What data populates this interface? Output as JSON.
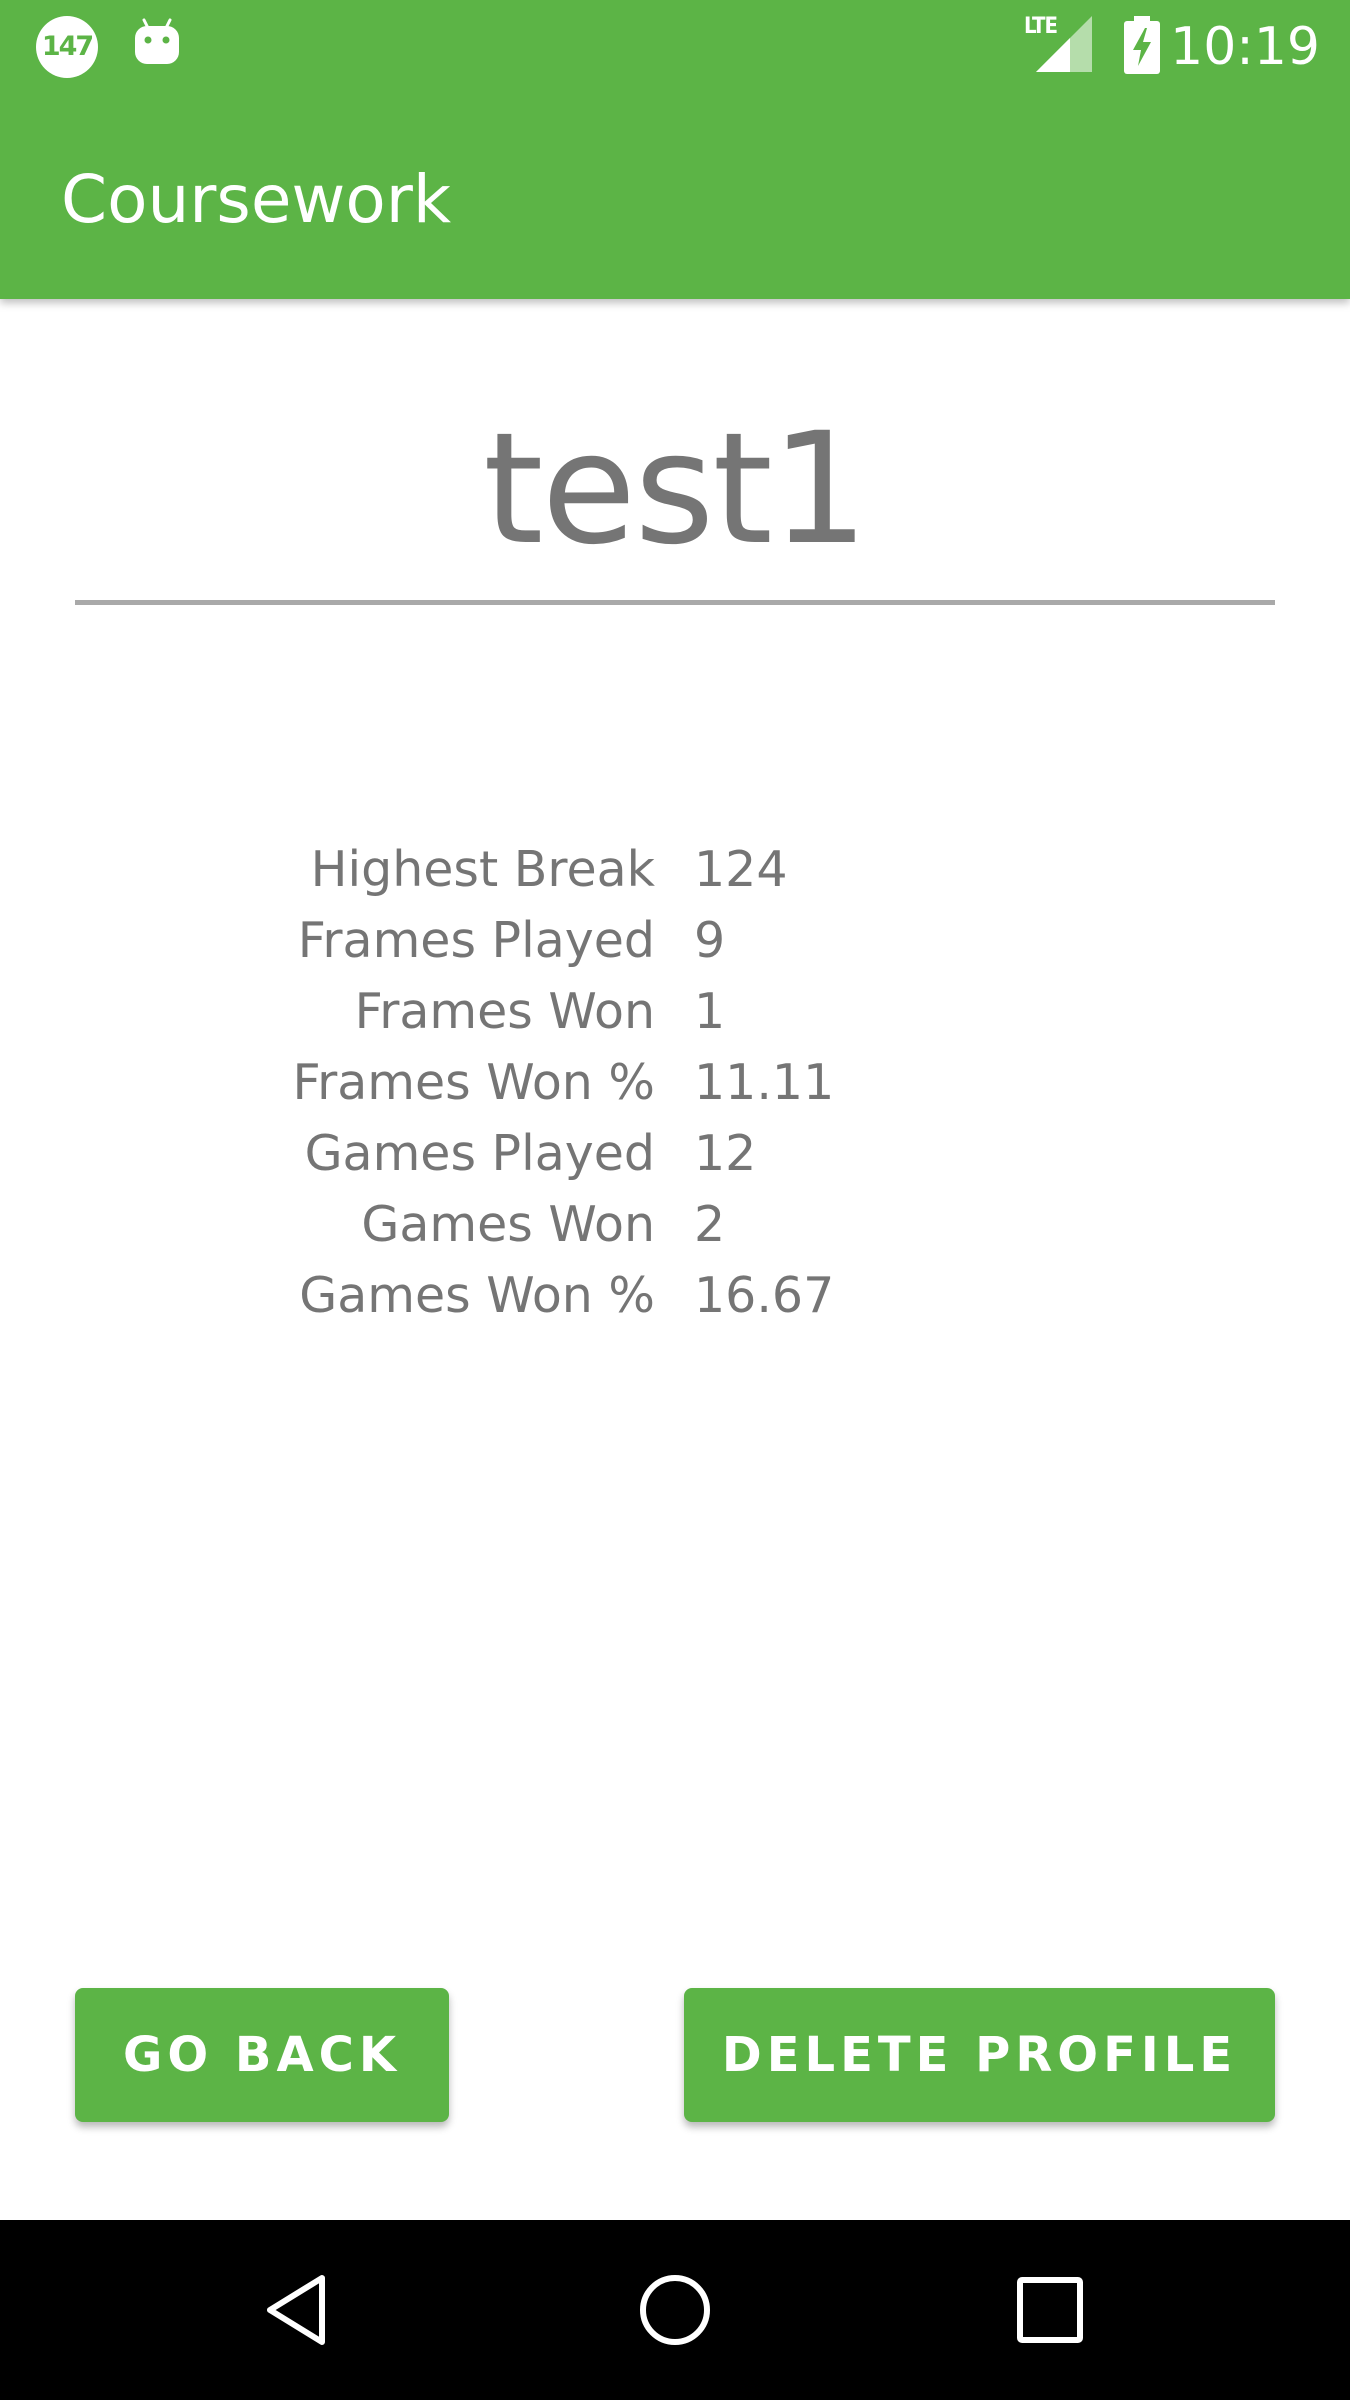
{
  "status_bar": {
    "notification_badge": "147",
    "network_label": "LTE",
    "time": "10:19",
    "icons": [
      "notification-badge-icon",
      "android-icon",
      "lte-signal-icon",
      "battery-charging-icon"
    ]
  },
  "app_bar": {
    "title": "Coursework"
  },
  "profile": {
    "name": "test1"
  },
  "stats": [
    {
      "label": "Highest Break",
      "value": "124"
    },
    {
      "label": "Frames Played",
      "value": "9"
    },
    {
      "label": "Frames Won",
      "value": "1"
    },
    {
      "label": "Frames Won %",
      "value": "11.11"
    },
    {
      "label": "Games Played",
      "value": "12"
    },
    {
      "label": "Games Won",
      "value": "2"
    },
    {
      "label": "Games Won %",
      "value": "16.67"
    }
  ],
  "buttons": {
    "go_back": "GO BACK",
    "delete_profile": "DELETE PROFILE"
  },
  "nav_bar": {
    "icons": [
      "back-triangle-icon",
      "home-circle-icon",
      "recents-square-icon"
    ]
  },
  "colors": {
    "primary": "#5cb446",
    "text_secondary": "#757575",
    "underline": "#a9a9a9",
    "nav_background": "#000000"
  }
}
